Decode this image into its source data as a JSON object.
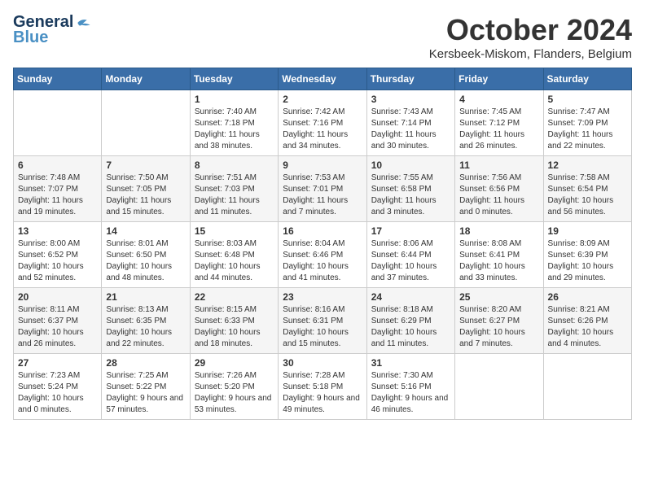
{
  "header": {
    "logo_general": "General",
    "logo_blue": "Blue",
    "month_title": "October 2024",
    "location": "Kersbeek-Miskom, Flanders, Belgium"
  },
  "weekdays": [
    "Sunday",
    "Monday",
    "Tuesday",
    "Wednesday",
    "Thursday",
    "Friday",
    "Saturday"
  ],
  "weeks": [
    [
      {
        "day": "",
        "sunrise": "",
        "sunset": "",
        "daylight": ""
      },
      {
        "day": "",
        "sunrise": "",
        "sunset": "",
        "daylight": ""
      },
      {
        "day": "1",
        "sunrise": "Sunrise: 7:40 AM",
        "sunset": "Sunset: 7:18 PM",
        "daylight": "Daylight: 11 hours and 38 minutes."
      },
      {
        "day": "2",
        "sunrise": "Sunrise: 7:42 AM",
        "sunset": "Sunset: 7:16 PM",
        "daylight": "Daylight: 11 hours and 34 minutes."
      },
      {
        "day": "3",
        "sunrise": "Sunrise: 7:43 AM",
        "sunset": "Sunset: 7:14 PM",
        "daylight": "Daylight: 11 hours and 30 minutes."
      },
      {
        "day": "4",
        "sunrise": "Sunrise: 7:45 AM",
        "sunset": "Sunset: 7:12 PM",
        "daylight": "Daylight: 11 hours and 26 minutes."
      },
      {
        "day": "5",
        "sunrise": "Sunrise: 7:47 AM",
        "sunset": "Sunset: 7:09 PM",
        "daylight": "Daylight: 11 hours and 22 minutes."
      }
    ],
    [
      {
        "day": "6",
        "sunrise": "Sunrise: 7:48 AM",
        "sunset": "Sunset: 7:07 PM",
        "daylight": "Daylight: 11 hours and 19 minutes."
      },
      {
        "day": "7",
        "sunrise": "Sunrise: 7:50 AM",
        "sunset": "Sunset: 7:05 PM",
        "daylight": "Daylight: 11 hours and 15 minutes."
      },
      {
        "day": "8",
        "sunrise": "Sunrise: 7:51 AM",
        "sunset": "Sunset: 7:03 PM",
        "daylight": "Daylight: 11 hours and 11 minutes."
      },
      {
        "day": "9",
        "sunrise": "Sunrise: 7:53 AM",
        "sunset": "Sunset: 7:01 PM",
        "daylight": "Daylight: 11 hours and 7 minutes."
      },
      {
        "day": "10",
        "sunrise": "Sunrise: 7:55 AM",
        "sunset": "Sunset: 6:58 PM",
        "daylight": "Daylight: 11 hours and 3 minutes."
      },
      {
        "day": "11",
        "sunrise": "Sunrise: 7:56 AM",
        "sunset": "Sunset: 6:56 PM",
        "daylight": "Daylight: 11 hours and 0 minutes."
      },
      {
        "day": "12",
        "sunrise": "Sunrise: 7:58 AM",
        "sunset": "Sunset: 6:54 PM",
        "daylight": "Daylight: 10 hours and 56 minutes."
      }
    ],
    [
      {
        "day": "13",
        "sunrise": "Sunrise: 8:00 AM",
        "sunset": "Sunset: 6:52 PM",
        "daylight": "Daylight: 10 hours and 52 minutes."
      },
      {
        "day": "14",
        "sunrise": "Sunrise: 8:01 AM",
        "sunset": "Sunset: 6:50 PM",
        "daylight": "Daylight: 10 hours and 48 minutes."
      },
      {
        "day": "15",
        "sunrise": "Sunrise: 8:03 AM",
        "sunset": "Sunset: 6:48 PM",
        "daylight": "Daylight: 10 hours and 44 minutes."
      },
      {
        "day": "16",
        "sunrise": "Sunrise: 8:04 AM",
        "sunset": "Sunset: 6:46 PM",
        "daylight": "Daylight: 10 hours and 41 minutes."
      },
      {
        "day": "17",
        "sunrise": "Sunrise: 8:06 AM",
        "sunset": "Sunset: 6:44 PM",
        "daylight": "Daylight: 10 hours and 37 minutes."
      },
      {
        "day": "18",
        "sunrise": "Sunrise: 8:08 AM",
        "sunset": "Sunset: 6:41 PM",
        "daylight": "Daylight: 10 hours and 33 minutes."
      },
      {
        "day": "19",
        "sunrise": "Sunrise: 8:09 AM",
        "sunset": "Sunset: 6:39 PM",
        "daylight": "Daylight: 10 hours and 29 minutes."
      }
    ],
    [
      {
        "day": "20",
        "sunrise": "Sunrise: 8:11 AM",
        "sunset": "Sunset: 6:37 PM",
        "daylight": "Daylight: 10 hours and 26 minutes."
      },
      {
        "day": "21",
        "sunrise": "Sunrise: 8:13 AM",
        "sunset": "Sunset: 6:35 PM",
        "daylight": "Daylight: 10 hours and 22 minutes."
      },
      {
        "day": "22",
        "sunrise": "Sunrise: 8:15 AM",
        "sunset": "Sunset: 6:33 PM",
        "daylight": "Daylight: 10 hours and 18 minutes."
      },
      {
        "day": "23",
        "sunrise": "Sunrise: 8:16 AM",
        "sunset": "Sunset: 6:31 PM",
        "daylight": "Daylight: 10 hours and 15 minutes."
      },
      {
        "day": "24",
        "sunrise": "Sunrise: 8:18 AM",
        "sunset": "Sunset: 6:29 PM",
        "daylight": "Daylight: 10 hours and 11 minutes."
      },
      {
        "day": "25",
        "sunrise": "Sunrise: 8:20 AM",
        "sunset": "Sunset: 6:27 PM",
        "daylight": "Daylight: 10 hours and 7 minutes."
      },
      {
        "day": "26",
        "sunrise": "Sunrise: 8:21 AM",
        "sunset": "Sunset: 6:26 PM",
        "daylight": "Daylight: 10 hours and 4 minutes."
      }
    ],
    [
      {
        "day": "27",
        "sunrise": "Sunrise: 7:23 AM",
        "sunset": "Sunset: 5:24 PM",
        "daylight": "Daylight: 10 hours and 0 minutes."
      },
      {
        "day": "28",
        "sunrise": "Sunrise: 7:25 AM",
        "sunset": "Sunset: 5:22 PM",
        "daylight": "Daylight: 9 hours and 57 minutes."
      },
      {
        "day": "29",
        "sunrise": "Sunrise: 7:26 AM",
        "sunset": "Sunset: 5:20 PM",
        "daylight": "Daylight: 9 hours and 53 minutes."
      },
      {
        "day": "30",
        "sunrise": "Sunrise: 7:28 AM",
        "sunset": "Sunset: 5:18 PM",
        "daylight": "Daylight: 9 hours and 49 minutes."
      },
      {
        "day": "31",
        "sunrise": "Sunrise: 7:30 AM",
        "sunset": "Sunset: 5:16 PM",
        "daylight": "Daylight: 9 hours and 46 minutes."
      },
      {
        "day": "",
        "sunrise": "",
        "sunset": "",
        "daylight": ""
      },
      {
        "day": "",
        "sunrise": "",
        "sunset": "",
        "daylight": ""
      }
    ]
  ]
}
